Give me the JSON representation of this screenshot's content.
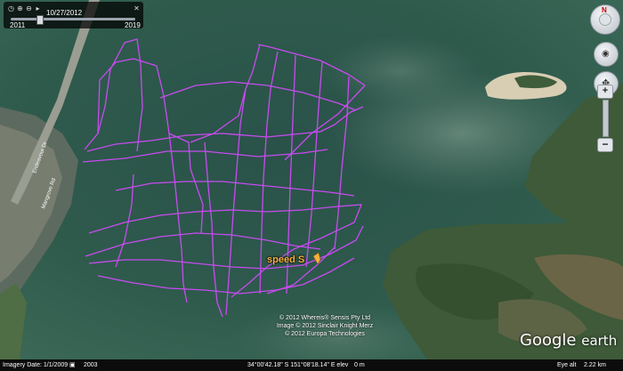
{
  "time_slider": {
    "current_date": "10/27/2012",
    "start_year": "2011",
    "end_year": "2019",
    "position_fraction": 0.23
  },
  "navigation": {
    "compass_north": "N"
  },
  "map": {
    "track_color": "#c84bf0",
    "water_color": "#2f5a50",
    "placemark_label": "speed S",
    "placemark_color": "#f2b13a",
    "road_label_1": "Endeavour Dr",
    "road_label_2": "Mangrove Rd"
  },
  "copyright": {
    "line1": "© 2012 Whereis® Sensis Pty Ltd",
    "line2": "Image © 2012 Sinclair Knight Merz",
    "line3": "© 2012 Europa Technologies"
  },
  "brand": {
    "google": "Google",
    "earth": "earth"
  },
  "status_bar": {
    "imagery_date": "Imagery Date: 1/1/2009",
    "year": "2003",
    "coordinates": "34°00'42.18\" S  151°08'18.14\" E  elev",
    "elevation": "0 m",
    "eye_alt_label": "Eye alt",
    "eye_alt_value": "2.22 km"
  }
}
